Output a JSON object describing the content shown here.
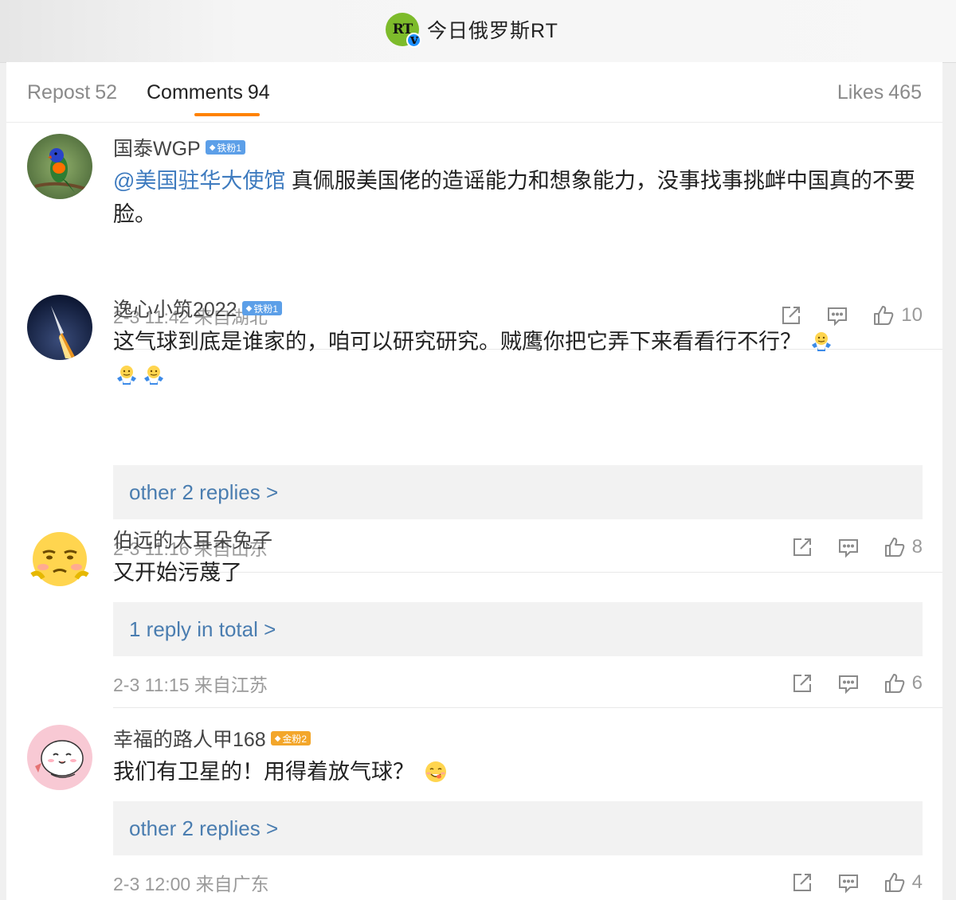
{
  "header": {
    "logo_text": "RT",
    "verified_mark": "v",
    "account_name": "今日俄罗斯RT"
  },
  "tabs": {
    "repost": {
      "label": "Repost",
      "count": "52"
    },
    "comments": {
      "label": "Comments",
      "count": "94"
    },
    "likes": {
      "label": "Likes",
      "count": "465"
    }
  },
  "colors": {
    "accent": "#ff8200",
    "link": "#3e7bbf",
    "reply_link": "#4a7db0",
    "muted": "#9a9a9a",
    "fan_badge": "#5c9fe8",
    "gold_badge": "#f3a62a",
    "rt_green": "#7dbb2b"
  },
  "comments": [
    {
      "username": "国泰WGP",
      "badge": "铁粉1",
      "mention": "@美国驻华大使馆",
      "text": " 真佩服美国佬的造谣能力和想象能力，没事找事挑衅中国真的不要脸。",
      "time": "2-3 11:42 来自湖北",
      "likes": "10",
      "avatar_icon": "parrot-avatar"
    },
    {
      "username": "逸心小筑2022",
      "badge": "铁粉1",
      "text": "这气球到底是谁家的，咱可以研究研究。贼鹰你把它弄下来看看行不行？",
      "replies": "other 2 replies >",
      "time": "2-3 11:16 来自山东",
      "likes": "8",
      "avatar_icon": "rocket-launch-avatar",
      "emoji_icon": "shrug-emoji"
    },
    {
      "username": "伯远的大耳朵兔子",
      "text": "又开始污蔑了",
      "replies": "1 reply in total >",
      "time": "2-3 11:15 来自江苏",
      "likes": "6",
      "avatar_icon": "sad-face-avatar"
    },
    {
      "username": "幸福的路人甲168",
      "badge": "金粉2",
      "text": "我们有卫星的！用得着放气球？",
      "replies": "other 2 replies >",
      "time": "2-3 12:00 来自广东",
      "likes": "4",
      "avatar_icon": "cartoon-blob-avatar",
      "emoji_icon": "yummy-emoji"
    }
  ]
}
